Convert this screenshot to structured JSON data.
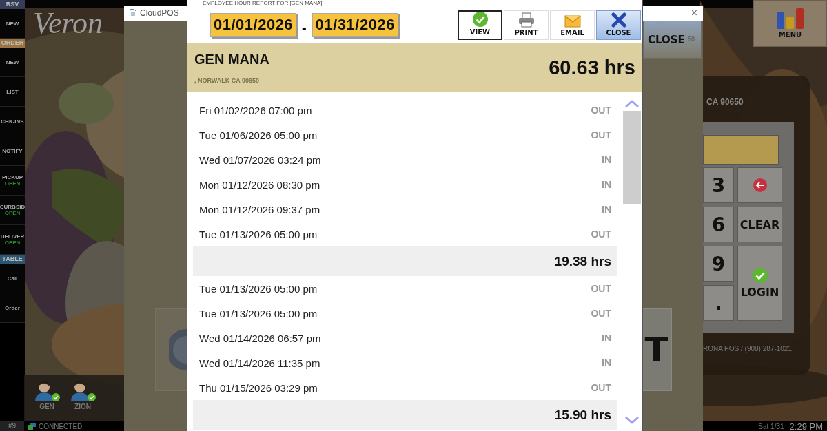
{
  "sidebar": {
    "items": [
      {
        "kind": "header",
        "label": "RSV",
        "color": "#353d58"
      },
      {
        "kind": "button",
        "label": "NEW"
      },
      {
        "kind": "header",
        "label": "ORDER",
        "color": "#9c7440"
      },
      {
        "kind": "button",
        "label": "NEW"
      },
      {
        "kind": "button",
        "label": "LIST"
      },
      {
        "kind": "button",
        "label": "CHK-INS"
      },
      {
        "kind": "button",
        "label": "NOTIFY"
      },
      {
        "kind": "button",
        "label": "PICKUP",
        "status": "OPEN"
      },
      {
        "kind": "button",
        "label": "CURBSID",
        "status": "OPEN"
      },
      {
        "kind": "button",
        "label": "DELIVER",
        "status": "OPEN"
      },
      {
        "kind": "header",
        "label": "TABLE",
        "color": "#2d5670"
      },
      {
        "kind": "button",
        "label": "Call"
      },
      {
        "kind": "button",
        "label": "Order"
      }
    ]
  },
  "logo": "Veron",
  "staff": [
    {
      "name": "GEN",
      "logged_in": true
    },
    {
      "name": "ZION",
      "logged_in": true
    }
  ],
  "menu_button": "MENU",
  "login_panel": {
    "address": "CA 90650",
    "keys": [
      {
        "kind": "digit",
        "label": "3"
      },
      {
        "kind": "back"
      },
      {
        "kind": "digit",
        "label": "6"
      },
      {
        "kind": "text",
        "label": "CLEAR"
      },
      {
        "kind": "digit",
        "label": "9"
      },
      {
        "kind": "login",
        "label": "LOGIN"
      },
      {
        "kind": "digit",
        "label": "."
      }
    ],
    "footer": "RONA POS / (908) 287-1021"
  },
  "status_bar": {
    "station": "#9",
    "connection": "CONNECTED",
    "date": "Sat 1/31",
    "time": "2:29 PM"
  },
  "cloudpos_window": {
    "title": "CloudPOS",
    "close_button": "CLOSE",
    "close_badge": "60",
    "side_key": "T",
    "close_icon": "×"
  },
  "report": {
    "title": "EMPLOYEE HOUR REPORT FOR [GEN MANA]",
    "start_date": "01/01/2026",
    "separator": "-",
    "end_date": "01/31/2026",
    "buttons": [
      {
        "kind": "view",
        "label": "VIEW",
        "selected": true,
        "highlighted": false
      },
      {
        "kind": "print",
        "label": "PRINT",
        "selected": false,
        "highlighted": false
      },
      {
        "kind": "email",
        "label": "EMAIL",
        "selected": false,
        "highlighted": false
      },
      {
        "kind": "close",
        "label": "CLOSE",
        "selected": false,
        "highlighted": true
      }
    ],
    "employee": {
      "name": "GEN MANA",
      "address": ", NORWALK CA 90650",
      "total": "60.63 hrs"
    },
    "rows": [
      {
        "kind": "punch",
        "time": "Fri 01/02/2026 07:00 pm",
        "type": "OUT"
      },
      {
        "kind": "punch",
        "time": "Tue 01/06/2026 05:00 pm",
        "type": "OUT"
      },
      {
        "kind": "punch",
        "time": "Wed 01/07/2026 03:24 pm",
        "type": "IN"
      },
      {
        "kind": "punch",
        "time": "Mon 01/12/2026 08:30 pm",
        "type": "IN"
      },
      {
        "kind": "punch",
        "time": "Mon 01/12/2026 09:37 pm",
        "type": "IN"
      },
      {
        "kind": "punch",
        "time": "Tue 01/13/2026 05:00 pm",
        "type": "OUT"
      },
      {
        "kind": "subtotal",
        "total": "19.38 hrs"
      },
      {
        "kind": "punch",
        "time": "Tue 01/13/2026 05:00 pm",
        "type": "OUT"
      },
      {
        "kind": "punch",
        "time": "Tue 01/13/2026 05:00 pm",
        "type": "OUT"
      },
      {
        "kind": "punch",
        "time": "Wed 01/14/2026 06:57 pm",
        "type": "IN"
      },
      {
        "kind": "punch",
        "time": "Wed 01/14/2026 11:35 pm",
        "type": "IN"
      },
      {
        "kind": "punch",
        "time": "Thu 01/15/2026 03:29 pm",
        "type": "OUT"
      },
      {
        "kind": "subtotal",
        "total": "15.90 hrs"
      }
    ]
  }
}
